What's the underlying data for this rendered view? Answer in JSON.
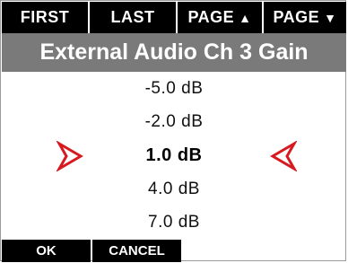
{
  "top_tabs": {
    "first": "FIRST",
    "last": "LAST",
    "page_up": "PAGE",
    "page_up_icon": "triangle-up-icon",
    "page_down": "PAGE",
    "page_down_icon": "triangle-down-icon"
  },
  "title": "External Audio Ch 3 Gain",
  "options": [
    "-5.0 dB",
    "-2.0 dB",
    "1.0 dB",
    "4.0 dB",
    "7.0 dB"
  ],
  "selected_index": 2,
  "selection_marker_icons": [
    "selector-right-arrow-icon",
    "selector-left-arrow-icon"
  ],
  "bottom_buttons": {
    "ok": "OK",
    "cancel": "CANCEL"
  },
  "colors": {
    "bar_bg": "#000000",
    "title_bg": "#7a7a7a",
    "accent_red": "#d71920",
    "text": "#111111"
  }
}
